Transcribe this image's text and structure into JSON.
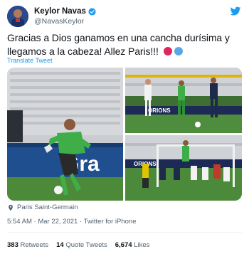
{
  "user": {
    "name": "Keylor Navas",
    "handle": "@NavasKeylor"
  },
  "tweet": {
    "text": "Gracias a Dios ganamos en una cancha durísima y llegamos a la cabeza! Allez Paris!!!",
    "translate_label": "Translate Tweet"
  },
  "media": {
    "photos": [
      {
        "ad_board": "Gra"
      },
      {
        "ad_board": "ORIONS"
      },
      {
        "ad_board": "ORIONS"
      }
    ]
  },
  "location": "Paris Saint-Germain",
  "meta": {
    "time": "5:54 AM",
    "date": "Mar 22, 2021",
    "separator": "·",
    "source": "Twitter for iPhone"
  },
  "stats": {
    "retweets_count": "383",
    "retweets_label": "Retweets",
    "quotes_count": "14",
    "quotes_label": "Quote Tweets",
    "likes_count": "6,674",
    "likes_label": "Likes"
  },
  "colors": {
    "accent": "#1d9bf0",
    "red_dot": "#e0245e",
    "blue_dot": "#5aa7e6"
  },
  "icons": [
    "verified-badge-icon",
    "twitter-bird-icon",
    "location-pin-icon"
  ]
}
